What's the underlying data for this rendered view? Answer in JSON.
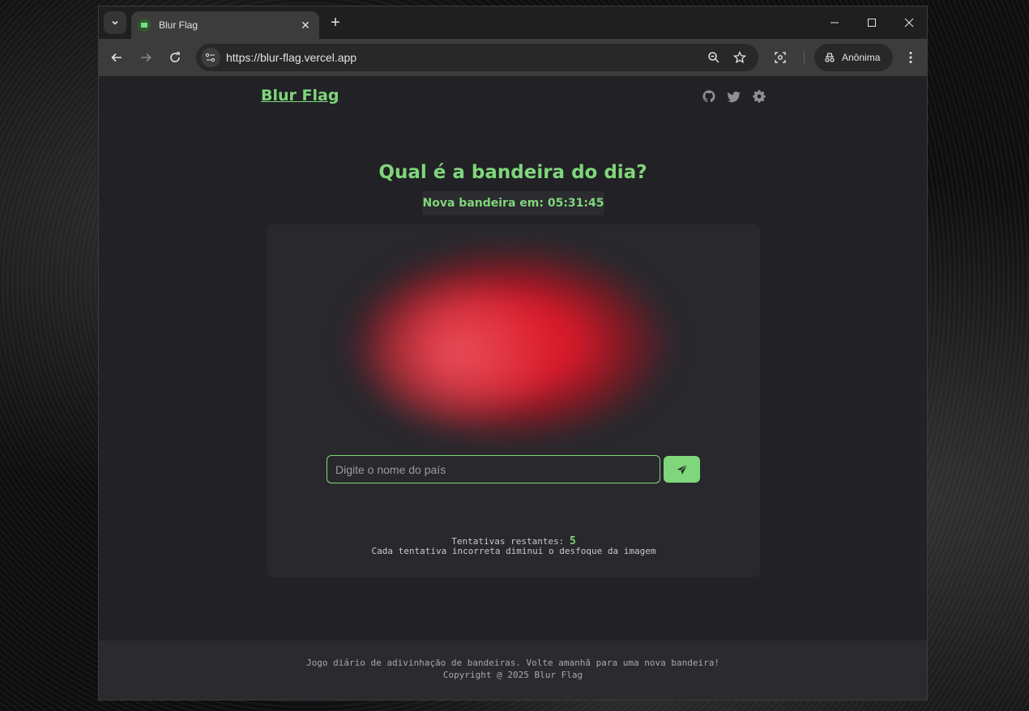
{
  "browser": {
    "tab_title": "Blur Flag",
    "url": "https://blur-flag.vercel.app",
    "profile_label": "Anônima"
  },
  "header": {
    "logo": "Blur Flag",
    "icons": [
      "github-icon",
      "twitter-icon",
      "settings-icon"
    ]
  },
  "game": {
    "question": "Qual é a bandeira do dia?",
    "timer": "Nova bandeira em: 05:31:45",
    "input_placeholder": "Digite o nome do país",
    "attempts_label": "Tentativas restantes:",
    "attempts_value": "5",
    "hint": "Cada tentativa incorreta diminui o desfoque da imagem",
    "accent_color": "#80d67a",
    "flag_color": "#e01a2b"
  },
  "footer": {
    "line1": "Jogo diário de adivinhação de bandeiras. Volte amanhã para uma nova bandeira!",
    "line2": "Copyright @ 2025 Blur Flag"
  }
}
